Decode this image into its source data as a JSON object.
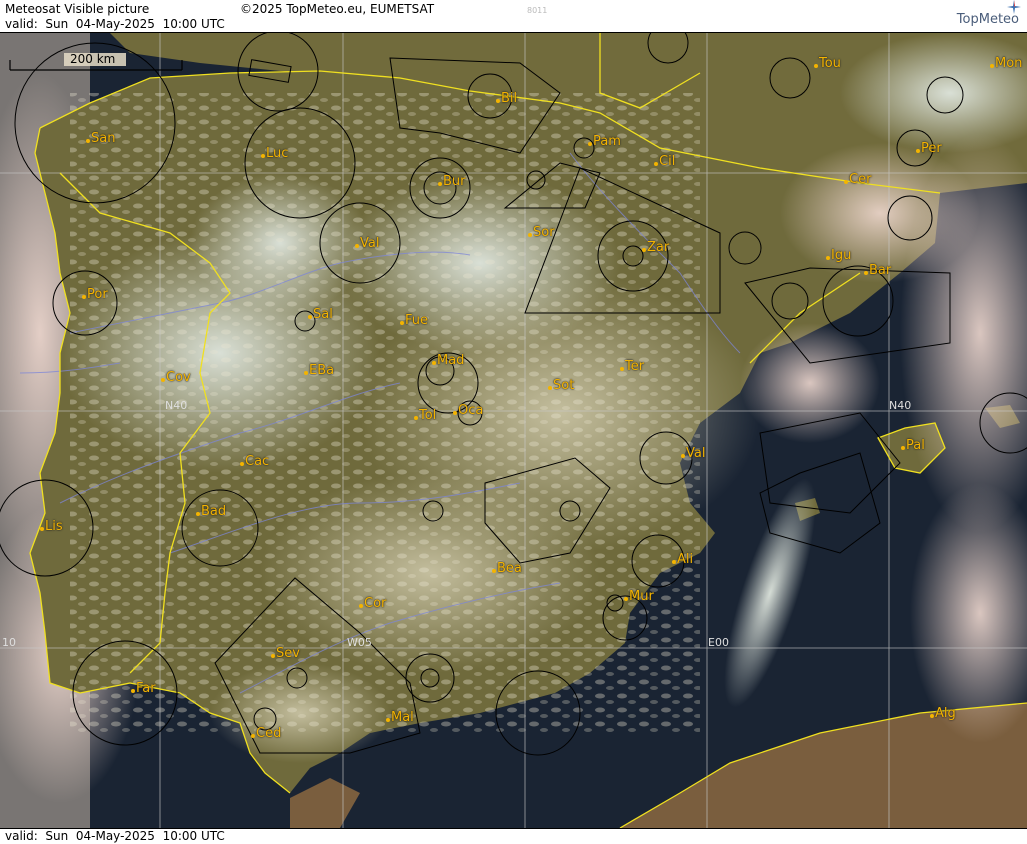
{
  "header": {
    "title": "Meteosat Visible picture",
    "copyright": "©2025 TopMeteo.eu, EUMETSAT",
    "image_code": "8011",
    "valid": "valid:  Sun  04-May-2025  10:00 UTC",
    "logo": "TopMeteo"
  },
  "footer": {
    "valid": "valid:  Sun  04-May-2025  10:00 UTC"
  },
  "scale": {
    "label": "200 km"
  },
  "grid_labels": {
    "n40_left": "N40",
    "n40_right": "N40",
    "w05": "W05",
    "e00": "E00",
    "w10": "10"
  },
  "colors": {
    "land": "#6f6a3c",
    "sea": "#1a2433",
    "border": "#f0e020",
    "label": "#f4b400",
    "grid": "#c8c8c8"
  },
  "cities": [
    {
      "name": "San"
    },
    {
      "name": "Luc"
    },
    {
      "name": "Bil"
    },
    {
      "name": "Pam"
    },
    {
      "name": "Tou"
    },
    {
      "name": "Mon"
    },
    {
      "name": "Per"
    },
    {
      "name": "Cil"
    },
    {
      "name": "Cer"
    },
    {
      "name": "Bur"
    },
    {
      "name": "Sor"
    },
    {
      "name": "Zar"
    },
    {
      "name": "Val"
    },
    {
      "name": "Igu"
    },
    {
      "name": "Bar"
    },
    {
      "name": "Por"
    },
    {
      "name": "Sal"
    },
    {
      "name": "Fue"
    },
    {
      "name": "Mad"
    },
    {
      "name": "Cov"
    },
    {
      "name": "EBa"
    },
    {
      "name": "Sot"
    },
    {
      "name": "Ter"
    },
    {
      "name": "Tol"
    },
    {
      "name": "Oca"
    },
    {
      "name": "Pal"
    },
    {
      "name": "Cac"
    },
    {
      "name": "Val"
    },
    {
      "name": "Lis"
    },
    {
      "name": "Bad"
    },
    {
      "name": "Ali"
    },
    {
      "name": "Bea"
    },
    {
      "name": "Mur"
    },
    {
      "name": "Cor"
    },
    {
      "name": "Sev"
    },
    {
      "name": "Far"
    },
    {
      "name": "Mal"
    },
    {
      "name": "Ced"
    },
    {
      "name": "Alg"
    }
  ]
}
